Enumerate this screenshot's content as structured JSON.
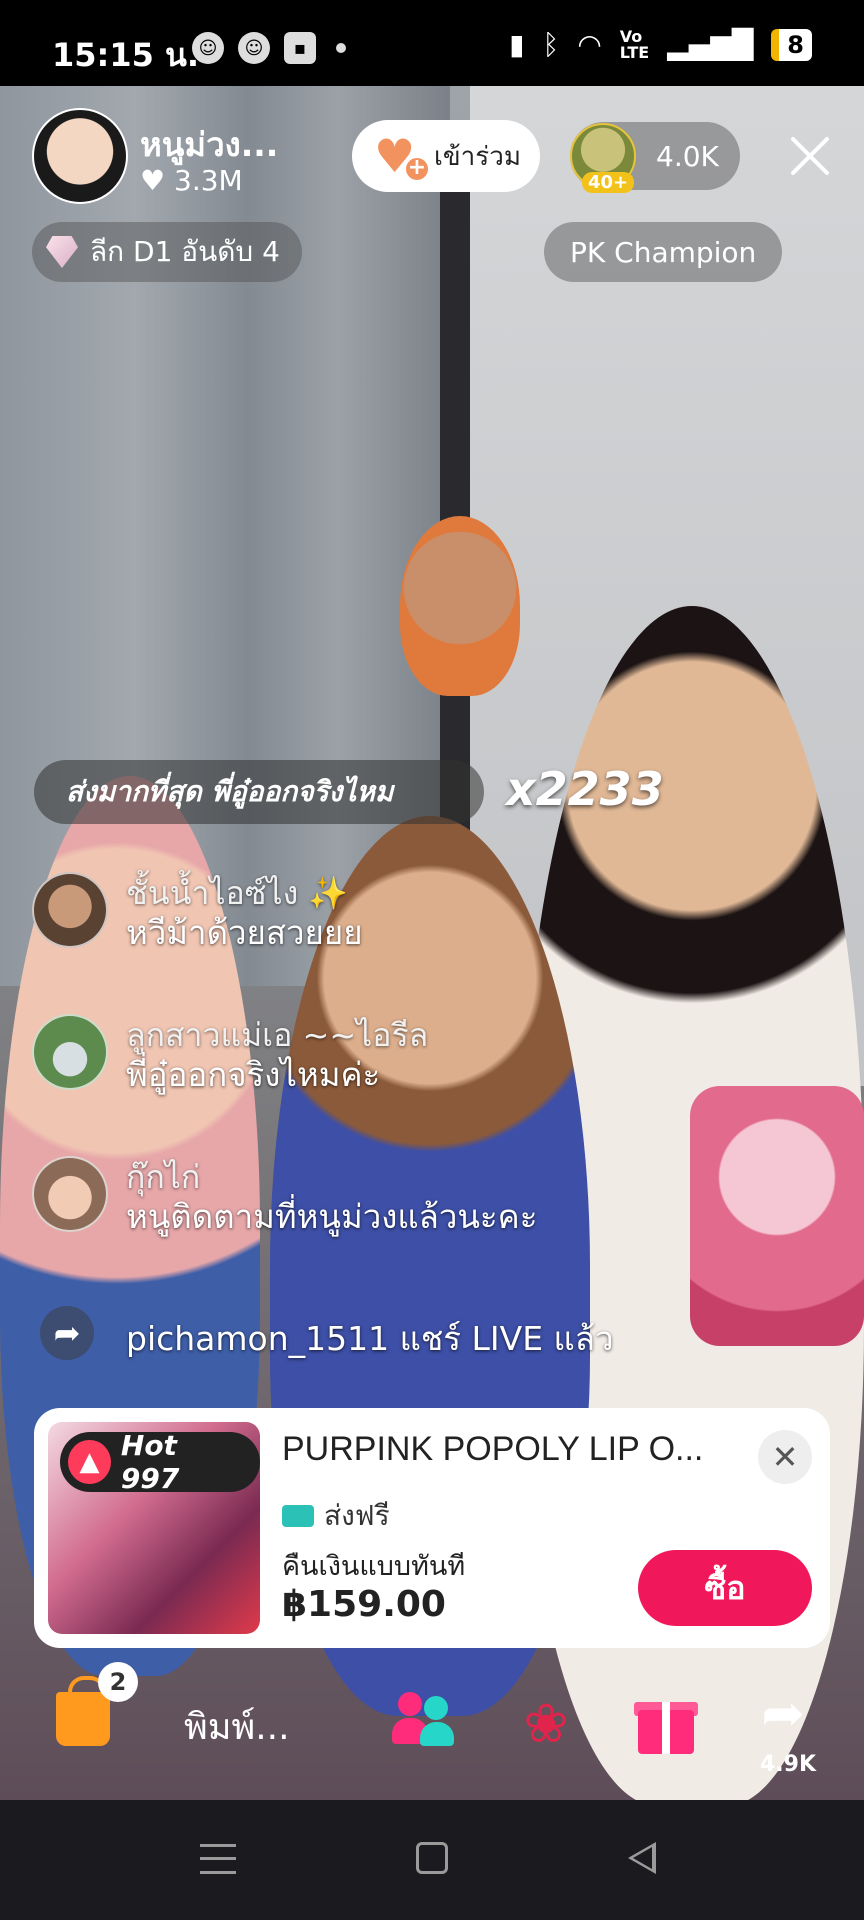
{
  "status_bar": {
    "time": "15:15 น.",
    "battery": "8"
  },
  "header": {
    "host_name": "หนูม่วง...",
    "host_likes": "3.3M",
    "join_label": "เข้าร่วม",
    "viewer_badge": "40+",
    "viewer_count": "4.0K",
    "league_label": "ลีก D1 อันดับ 4",
    "pk_label": "PK Champion"
  },
  "gift_banner": {
    "text": "ส่งมากที่สุด พี่อู๋ออกจริงไหม",
    "count": "x2233"
  },
  "comments": [
    {
      "name": "ชั้นน้ำไอซ์ไง ✨",
      "text": "หวีม้าด้วยสวยยย"
    },
    {
      "name": "ลูกสาวแม่เอ ~~ไอรีล",
      "text": "พี่อู๋ออกจริงไหมค่ะ"
    },
    {
      "name": "กุ๊กไก่",
      "text": "หนูติดตามที่หนูม่วงแล้วนะคะ"
    }
  ],
  "share_notice": "pichamon_1511 แชร์ LIVE แล้ว",
  "product": {
    "hot_label": "Hot 997",
    "title": "PURPINK POPOLY LIP O...",
    "shipping": "ส่งฟรี",
    "refund": "คืนเงินแบบทันที",
    "price": "฿159.00",
    "buy_label": "ซื้อ"
  },
  "bottom_bar": {
    "cart_badge": "2",
    "input_placeholder": "พิมพ์...",
    "share_count": "4.9K"
  },
  "colors": {
    "accent": "#fe2c55",
    "buy_button": "#f0175a",
    "join_heart": "#f2935f"
  }
}
